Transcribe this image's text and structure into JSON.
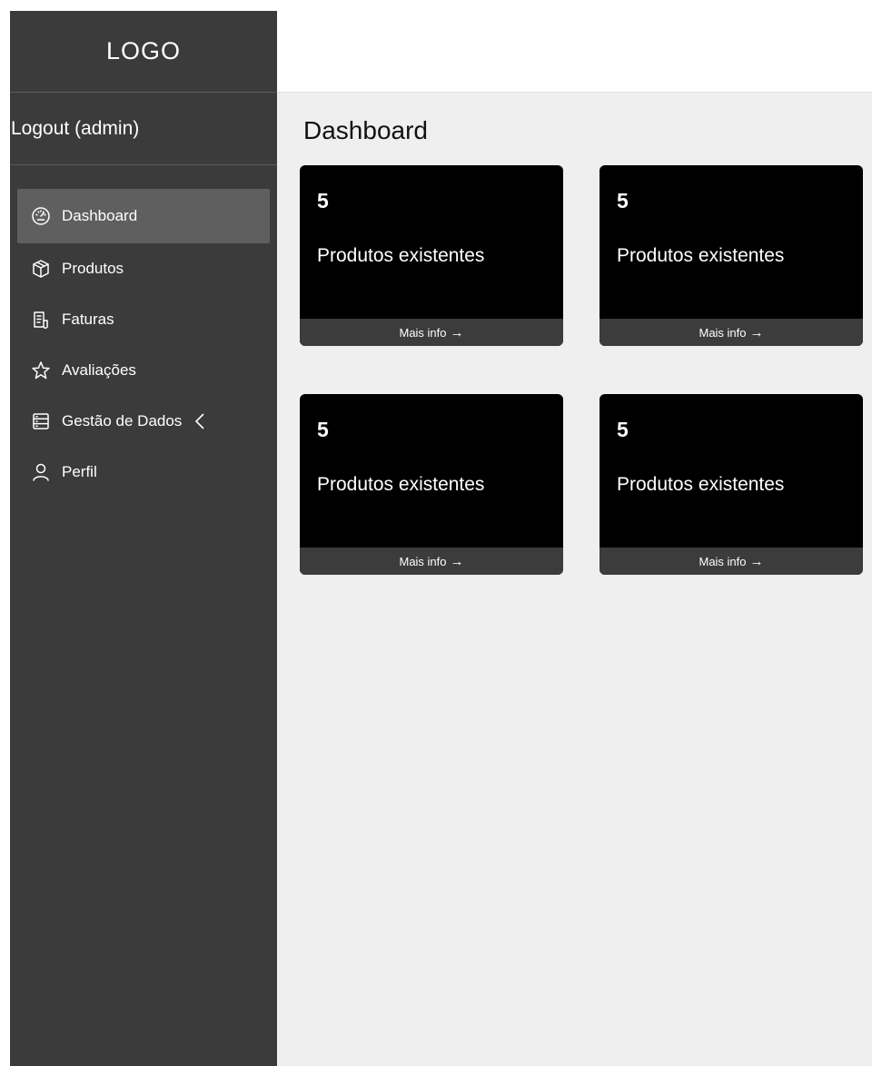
{
  "sidebar": {
    "logo": "LOGO",
    "logout": "Logout (admin)",
    "items": [
      {
        "label": "Dashboard",
        "icon": "dashboard-gauge-icon",
        "active": true
      },
      {
        "label": "Produtos",
        "icon": "box-icon"
      },
      {
        "label": "Faturas",
        "icon": "invoice-icon"
      },
      {
        "label": "Avaliações",
        "icon": "star-icon"
      },
      {
        "label": "Gestão de Dados",
        "icon": "database-icon",
        "expand_icon": "chevron-left-icon"
      },
      {
        "label": "Perfil",
        "icon": "user-icon"
      }
    ]
  },
  "main": {
    "title": "Dashboard",
    "cards": [
      {
        "count": "5",
        "label": "Produtos existentes",
        "link": "Mais info",
        "link_icon": "arrow-right-icon"
      },
      {
        "count": "5",
        "label": "Produtos existentes",
        "link": "Mais info",
        "link_icon": "arrow-right-icon"
      },
      {
        "count": "5",
        "label": "Produtos existentes",
        "link": "Mais info",
        "link_icon": "arrow-right-icon"
      },
      {
        "count": "5",
        "label": "Produtos existentes",
        "link": "Mais info",
        "link_icon": "arrow-right-icon"
      }
    ]
  },
  "colors": {
    "sidebar_bg": "#3b3b3b",
    "active_item_bg": "#5f5f5f",
    "main_bg": "#efefef",
    "card_bg": "#000000",
    "card_footer_bg": "#3c3c3c"
  }
}
